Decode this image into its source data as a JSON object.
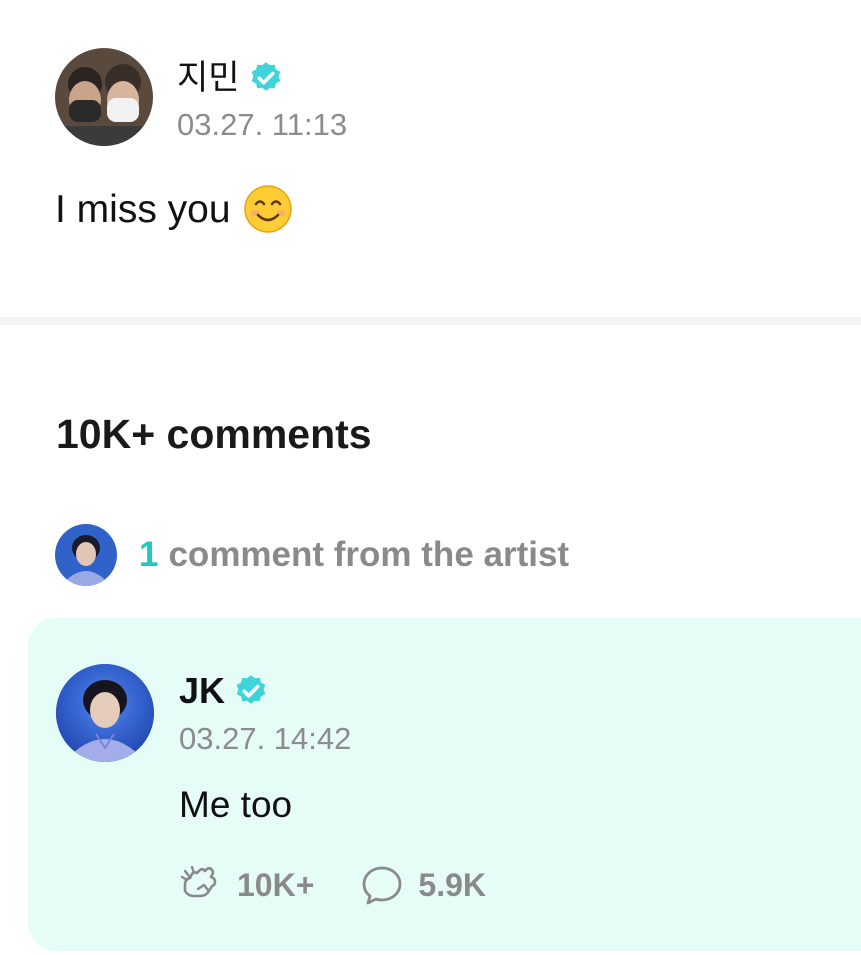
{
  "post": {
    "author": {
      "name": "지민",
      "verified": true,
      "avatar_icon": "avatar-jimin-masked-photo"
    },
    "timestamp": "03.27. 11:13",
    "text": "I miss you",
    "emoji_icon": "smiling-face-emoji-icon"
  },
  "comments": {
    "count_label": "10K+ comments",
    "artist_summary": {
      "count": "1",
      "text": "comment from the artist"
    },
    "artist_comment": {
      "author": {
        "name": "JK",
        "verified": true,
        "avatar_icon": "avatar-jk-photo"
      },
      "timestamp": "03.27. 14:42",
      "text": "Me too",
      "likes_label": "10K+",
      "replies_label": "5.9K",
      "like_icon": "cheer-hand-icon",
      "reply_icon": "speech-bubble-icon"
    }
  },
  "colors": {
    "accent": "#1fc9bd",
    "verified_badge": "#3ed4d9",
    "card_background": "#e6fcf6",
    "muted_text": "#8c8c8c"
  }
}
